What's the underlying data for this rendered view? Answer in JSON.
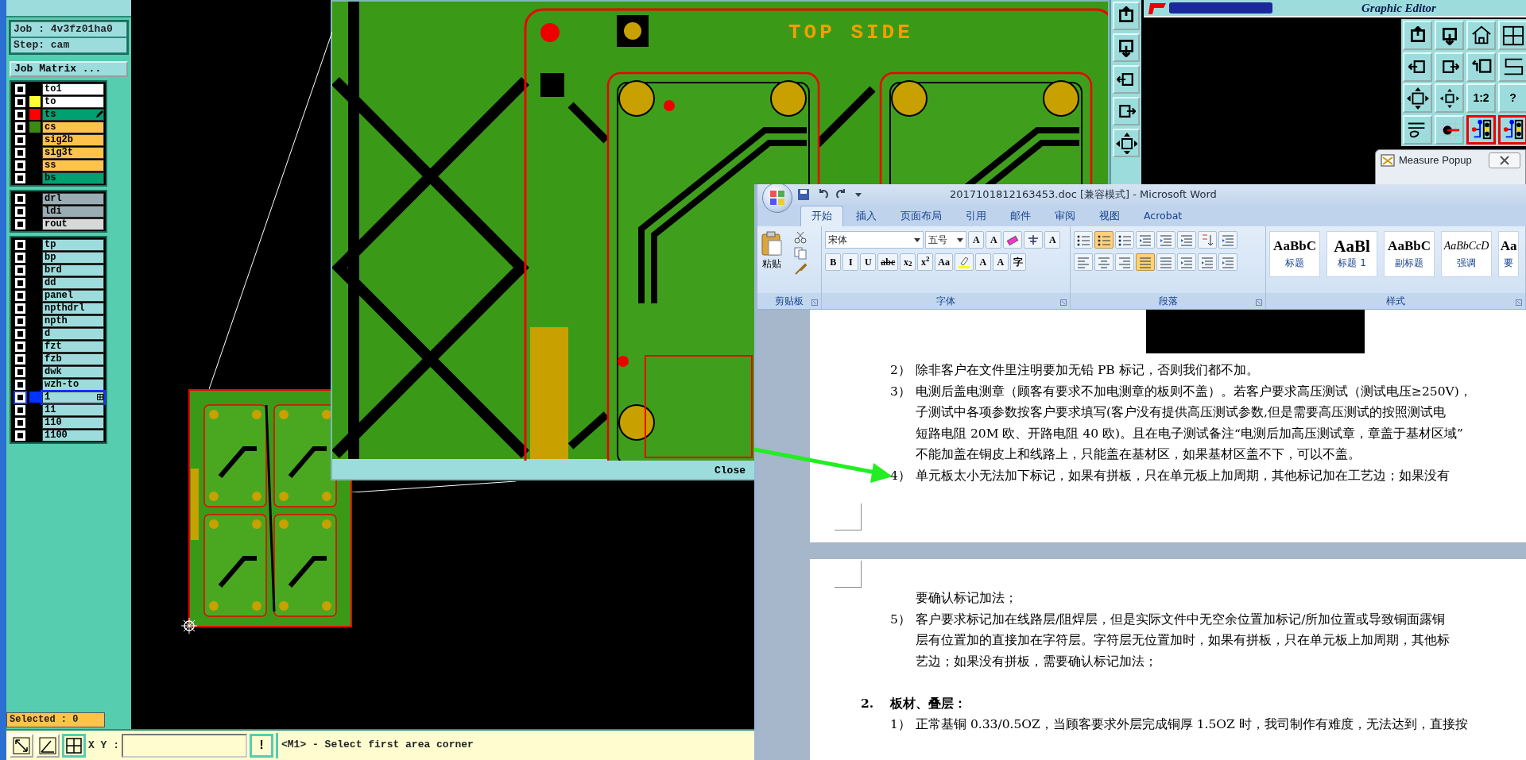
{
  "left_panel": {
    "job": "Job : 4v3fz01ha0",
    "step": "Step: cam",
    "job_matrix_button": "Job Matrix ...",
    "layer_groups": [
      [
        {
          "name": "to1",
          "kind": "silk",
          "checked": false,
          "selected": false,
          "work": false
        },
        {
          "name": "to",
          "kind": "silk",
          "color": "#ffff33",
          "checked": false,
          "selected": false,
          "work": false
        },
        {
          "name": "ts",
          "kind": "mask",
          "color": "#ff0000",
          "checked": false,
          "selected": false,
          "work": true
        },
        {
          "name": "cs",
          "kind": "signal",
          "color": "#3c8a10",
          "checked": false,
          "selected": false,
          "work": false
        },
        {
          "name": "sig2b",
          "kind": "signal",
          "checked": false,
          "selected": false,
          "work": false
        },
        {
          "name": "sig3t",
          "kind": "signal",
          "checked": false,
          "selected": false,
          "work": false
        },
        {
          "name": "ss",
          "kind": "signal",
          "checked": false,
          "selected": false,
          "work": false
        },
        {
          "name": "bs",
          "kind": "mask",
          "checked": false,
          "selected": false,
          "work": false
        }
      ],
      [
        {
          "name": "drl",
          "kind": "drill",
          "checked": false,
          "selected": false,
          "work": false
        },
        {
          "name": "ldi",
          "kind": "drill",
          "checked": false,
          "selected": false,
          "work": false
        },
        {
          "name": "rout",
          "kind": "rout",
          "checked": false,
          "selected": false,
          "work": false
        }
      ],
      [
        {
          "name": "tp",
          "kind": "document",
          "checked": false,
          "selected": false,
          "work": false
        },
        {
          "name": "bp",
          "kind": "document",
          "checked": false,
          "selected": false,
          "work": false
        },
        {
          "name": "brd",
          "kind": "document",
          "checked": false,
          "selected": false,
          "work": false
        },
        {
          "name": "dd",
          "kind": "document",
          "checked": false,
          "selected": false,
          "work": false
        },
        {
          "name": "panel",
          "kind": "document",
          "checked": false,
          "selected": false,
          "work": false
        },
        {
          "name": "npthdrl",
          "kind": "document",
          "checked": false,
          "selected": false,
          "work": false
        },
        {
          "name": "npth",
          "kind": "document",
          "checked": false,
          "selected": false,
          "work": false
        },
        {
          "name": "d",
          "kind": "document",
          "checked": false,
          "selected": false,
          "work": false
        },
        {
          "name": "fzt",
          "kind": "document",
          "checked": false,
          "selected": false,
          "work": false
        },
        {
          "name": "fzb",
          "kind": "document",
          "checked": false,
          "selected": false,
          "work": false
        },
        {
          "name": "dwk",
          "kind": "document",
          "checked": false,
          "selected": false,
          "work": false
        },
        {
          "name": "wzh-to",
          "kind": "document",
          "checked": false,
          "selected": false,
          "work": false
        },
        {
          "name": "1",
          "kind": "document",
          "color": "#0033ff",
          "checked": false,
          "selected": true,
          "work": false
        },
        {
          "name": "11",
          "kind": "document",
          "checked": false,
          "selected": false,
          "work": false
        },
        {
          "name": "110",
          "kind": "document",
          "checked": false,
          "selected": false,
          "work": false
        },
        {
          "name": "1100",
          "kind": "document",
          "checked": false,
          "selected": false,
          "work": false
        }
      ]
    ],
    "selected_count": "Selected : 0"
  },
  "zoom_window": {
    "board_title": "TOP SIDE",
    "close_button": "Close"
  },
  "header": {
    "subtitle": "Graphic Editor"
  },
  "tool_grid": [
    {
      "kind": "up"
    },
    {
      "kind": "down"
    },
    {
      "kind": "home"
    },
    {
      "kind": "grid"
    },
    {
      "kind": "left"
    },
    {
      "kind": "right"
    },
    {
      "kind": "undo"
    },
    {
      "kind": "snake"
    },
    {
      "kind": "fit"
    },
    {
      "kind": "center"
    },
    {
      "kind": "text",
      "label": "1:2"
    },
    {
      "kind": "text",
      "label": "?"
    },
    {
      "kind": "tools"
    },
    {
      "kind": "pad"
    },
    {
      "kind": "netlist"
    },
    {
      "kind": "netlist"
    }
  ],
  "measure_popup": {
    "title": "Measure Popup"
  },
  "word": {
    "title": "2017101812163453.doc [兼容模式] - Microsoft Word",
    "tabs": [
      {
        "label": "开始",
        "selected": true
      },
      {
        "label": "插入",
        "selected": false
      },
      {
        "label": "页面布局",
        "selected": false
      },
      {
        "label": "引用",
        "selected": false
      },
      {
        "label": "邮件",
        "selected": false
      },
      {
        "label": "审阅",
        "selected": false
      },
      {
        "label": "视图",
        "selected": false
      },
      {
        "label": "Acrobat",
        "selected": false
      }
    ],
    "ribbon": {
      "paste": "粘贴",
      "clipboard_group": "剪贴板",
      "font_name": "宋体",
      "font_size": "五号",
      "font_group": "字体",
      "font_buttons_top": [
        {
          "kind": "text",
          "label": "A"
        },
        {
          "kind": "text",
          "label": "A"
        },
        {
          "kind": "eraser"
        },
        {
          "kind": "phonetic"
        },
        {
          "kind": "text",
          "label": "A"
        }
      ],
      "font_buttons_bottom": [
        {
          "kind": "text",
          "label": "B"
        },
        {
          "kind": "text",
          "label": "I"
        },
        {
          "kind": "text",
          "label": "U"
        },
        {
          "kind": "text",
          "label": "abc"
        },
        {
          "kind": "text",
          "label": "x$_{2}$"
        },
        {
          "kind": "text",
          "label": "x$^{2}$"
        },
        {
          "kind": "text",
          "label": "Aa"
        },
        {
          "kind": "highlight"
        },
        {
          "kind": "text",
          "label": "A"
        },
        {
          "kind": "text",
          "label": "A"
        },
        {
          "kind": "text",
          "label": "字"
        }
      ],
      "paragraph_group": "段落",
      "paragraph_buttons": [
        [
          {
            "kind": "bullets",
            "on": false
          },
          {
            "kind": "numbering",
            "on": true
          },
          {
            "kind": "multilevel",
            "on": false
          },
          {
            "kind": "outdent",
            "on": false
          },
          {
            "kind": "indent",
            "on": false
          },
          {
            "kind": "asian",
            "on": false
          },
          {
            "kind": "sort",
            "on": false
          },
          {
            "kind": "marks",
            "on": false
          }
        ],
        [
          {
            "kind": "left",
            "on": false
          },
          {
            "kind": "center",
            "on": false
          },
          {
            "kind": "right",
            "on": false
          },
          {
            "kind": "justify",
            "on": true
          },
          {
            "kind": "distributed",
            "on": false
          },
          {
            "kind": "spacing",
            "on": false
          },
          {
            "kind": "shading",
            "on": false
          },
          {
            "kind": "borders",
            "on": false
          }
        ]
      ],
      "styles": [
        {
          "preview": "AaBbC",
          "name": "标题"
        },
        {
          "preview": "AaBl",
          "name": "标题 1"
        },
        {
          "preview": "AaBbC",
          "name": "副标题"
        },
        {
          "preview": "AaBbCcD",
          "name": "强调"
        },
        {
          "preview": "Aa",
          "name": "要"
        }
      ],
      "styles_group": "样式"
    },
    "pages": [
      {
        "blocks": [
          {
            "kind": "image"
          },
          {
            "kind": "item",
            "number": "2）",
            "lines": [
              "除非客户在文件里注明要加无铅 PB 标记，否则我们都不加。"
            ]
          },
          {
            "kind": "item",
            "number": "3）",
            "lines": [
              "电测后盖电测章（顾客有要求不加电测章的板则不盖）。若客户要求高压测试（测试电压≥250V)，",
              "子测试中各项参数按客户要求填写(客户没有提供高压测试参数,但是需要高压测试的按照测试电",
              "短路电阻 20M 欧、开路电阻 40 欧)。且在电子测试备注“电测后加高压测试章，章盖于基材区域”",
              "不能加盖在铜皮上和线路上，只能盖在基材区，如果基材区盖不下，可以不盖。"
            ]
          },
          {
            "kind": "item",
            "number": "4）",
            "lines": [
              "单元板太小无法加下标记，如果有拼板，只在单元板上加周期，其他标记加在工艺边；如果没有"
            ]
          }
        ]
      },
      {
        "blocks": [
          {
            "kind": "continuation",
            "lines": [
              "要确认标记加法；"
            ]
          },
          {
            "kind": "item",
            "number": "5）",
            "lines": [
              "客户要求标记加在线路层/阻焊层，但是实际文件中无空余位置加标记/所加位置或导致铜面露铜",
              "层有位置加的直接加在字符层。字符层无位置加时，如果有拼板，只在单元板上加周期，其他标",
              "艺边；如果没有拼板，需要确认标记加法；"
            ]
          },
          {
            "kind": "blank"
          },
          {
            "kind": "heading",
            "number": "2.",
            "text": "板材、叠层："
          },
          {
            "kind": "item",
            "number": "1）",
            "lines": [
              "正常基铜 0.33/0.5OZ，当顾客要求外层完成铜厚 1.5OZ 时，我司制作有难度，无法达到，直接按"
            ]
          }
        ]
      }
    ]
  },
  "command_bar": {
    "xy_label": "X Y :",
    "alert_button": "!",
    "message": "<M1> - Select first area corner"
  }
}
